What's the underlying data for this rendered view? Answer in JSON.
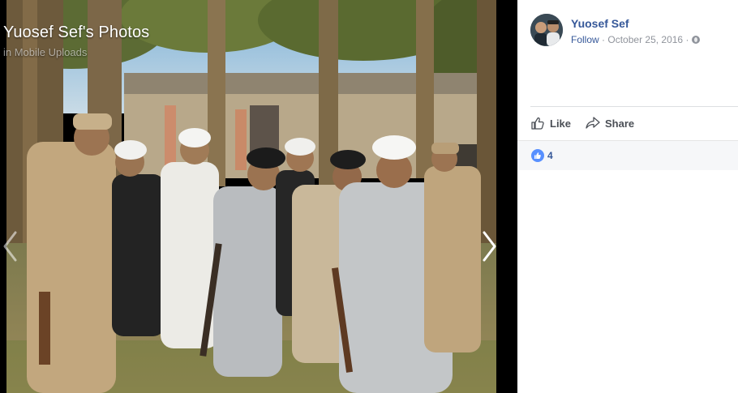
{
  "viewer": {
    "title": "Yuosef Sef's Photos",
    "subtitle": "in Mobile Uploads"
  },
  "post": {
    "owner_name": "Yuosef Sef",
    "follow_label": "Follow",
    "separator": "·",
    "date": "October 25, 2016",
    "privacy_icon": "globe-icon"
  },
  "actions": {
    "like_label": "Like",
    "share_label": "Share"
  },
  "reactions": {
    "count": "4",
    "icon": "thumbs-up-icon"
  },
  "colors": {
    "link": "#365899",
    "reaction_blue": "#5890ff",
    "muted": "#90949c"
  }
}
